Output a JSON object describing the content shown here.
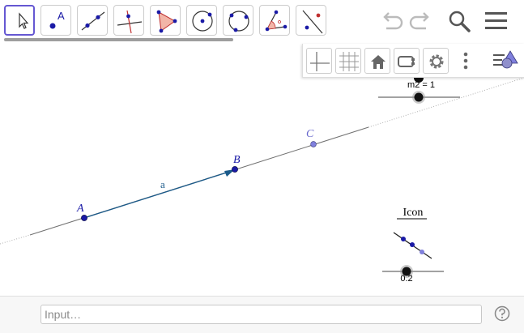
{
  "toolbar": {
    "tools": [
      {
        "name": "move"
      },
      {
        "name": "point"
      },
      {
        "name": "line"
      },
      {
        "name": "perpendicular-line"
      },
      {
        "name": "polygon"
      },
      {
        "name": "circle-center-point"
      },
      {
        "name": "circle-three-points"
      },
      {
        "name": "angle"
      },
      {
        "name": "reflect-about-line"
      }
    ],
    "selected_tool": "move"
  },
  "header_icons": [
    "undo-icon",
    "redo-icon",
    "search-icon",
    "menu-icon"
  ],
  "style_bar": {
    "buttons": [
      "axes-toggle",
      "grid-toggle",
      "standard-view",
      "navigation-bar",
      "graphics-settings",
      "more-options",
      "toggle-style-bar"
    ]
  },
  "graphics": {
    "points": {
      "A": "A",
      "B": "B",
      "C": "C"
    },
    "vector_label": "a",
    "slider_m2_label": "m2 = 1",
    "icon_caption": "Icon",
    "slider_bottom_value": "0.2"
  },
  "input_bar": {
    "placeholder": "Input…"
  },
  "colors": {
    "accent": "#6557d2",
    "point": "#1a1aa6",
    "vector": "#1a5a8a",
    "point_c": "#6666cc"
  }
}
